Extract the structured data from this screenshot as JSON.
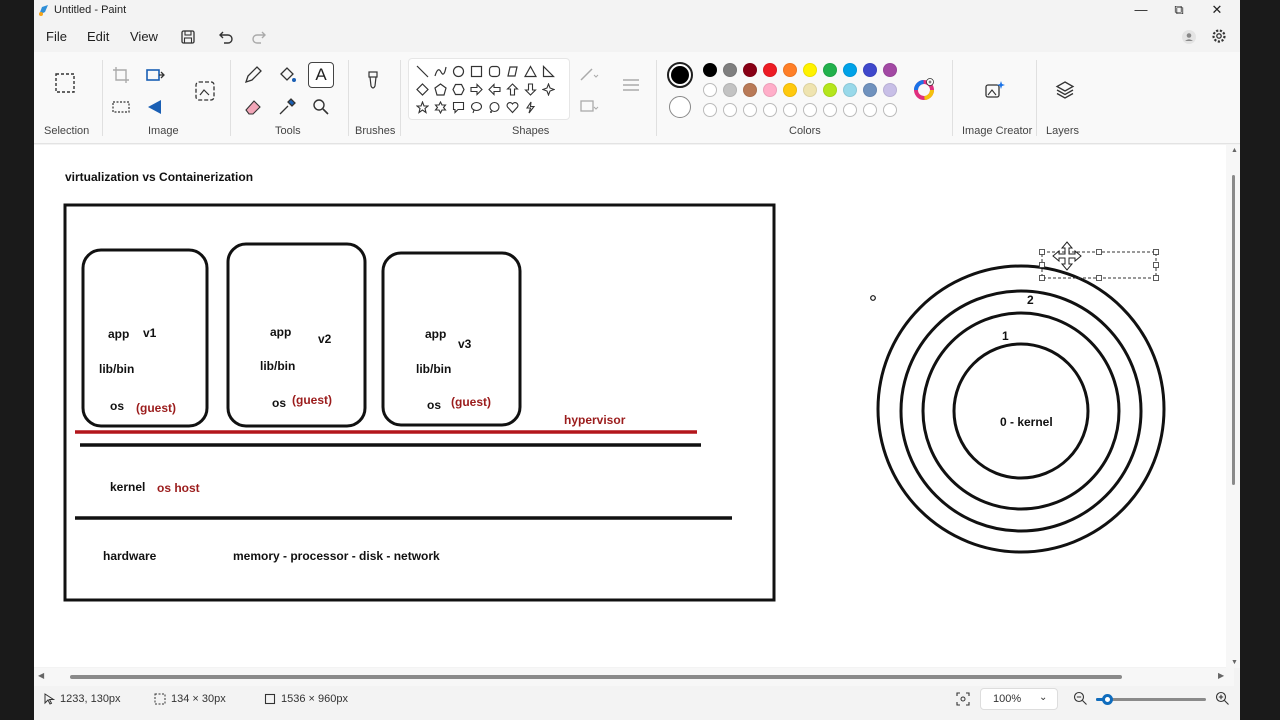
{
  "window": {
    "title": "Untitled - Paint",
    "minimize": "—",
    "maximize": "⧉",
    "close": "✕"
  },
  "menu": {
    "file": "File",
    "edit": "Edit",
    "view": "View"
  },
  "ribbon": {
    "selection": "Selection",
    "image": "Image",
    "tools": "Tools",
    "brushes": "Brushes",
    "shapes": "Shapes",
    "colors": "Colors",
    "image_creator": "Image Creator",
    "layers": "Layers"
  },
  "palette": {
    "row1": [
      "#000000",
      "#7f7f7f",
      "#880015",
      "#ed1c24",
      "#ff7f27",
      "#fff200",
      "#22b14c",
      "#00a2e8",
      "#3f48cc",
      "#a349a4"
    ],
    "row2": [
      "#ffffff",
      "#c3c3c3",
      "#b97a57",
      "#ffaec9",
      "#ffc90e",
      "#efe4b0",
      "#b5e61d",
      "#99d9ea",
      "#7092be",
      "#c8bfe7"
    ]
  },
  "canvas": {
    "heading": "virtualization vs Containerization",
    "vm1": {
      "app": "app",
      "ver": "v1",
      "lib": "lib/bin",
      "os": "os",
      "guest": "(guest)"
    },
    "vm2": {
      "app": "app",
      "ver": "v2",
      "lib": "lib/bin",
      "os": "os",
      "guest": "(guest)"
    },
    "vm3": {
      "app": "app",
      "ver": "v3",
      "lib": "lib/bin",
      "os": "os",
      "guest": "(guest)"
    },
    "hypervisor": "hypervisor",
    "kernel": "kernel",
    "os_host": "os host",
    "hardware": "hardware",
    "resources": "memory - processor - disk - network",
    "ring2": "2",
    "ring1": "1",
    "ring0": "0 - kernel"
  },
  "status": {
    "cursor": "1233, 130px",
    "selection_size": "134 × 30px",
    "canvas_size": "1536 × 960px",
    "zoom": "100%",
    "zoom_level": 0.1
  }
}
